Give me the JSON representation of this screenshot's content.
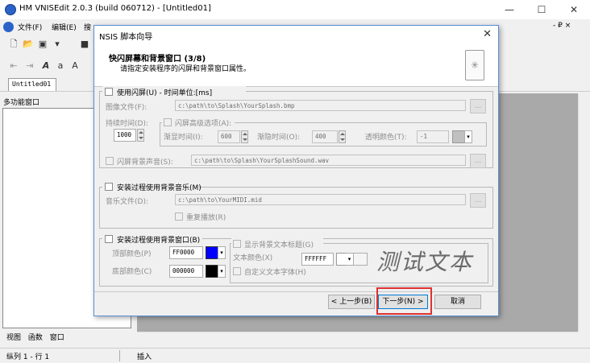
{
  "app": {
    "title": "HM VNISEdit 2.0.3 (build 060712) - [Untitled01]",
    "menu": [
      "文件(F)",
      "编辑(E)",
      "搜"
    ],
    "mdi_controls": "- ₽ ×"
  },
  "tabs": {
    "document": "Untitled01"
  },
  "left_panel": {
    "title": "多功能窗口",
    "tabs": [
      "视图",
      "函数",
      "窗口"
    ]
  },
  "status": {
    "position": "纵列 1 - 行 1",
    "mode": "插入"
  },
  "dialog": {
    "title": "NSIS 脚本向导",
    "heading": "快闪屏幕和背景窗口 (3/8)",
    "subheading": "请指定安装程序的闪屏和背景窗口属性。",
    "splash": {
      "group_label": "使用闪屏(U) - 时间单位:[ms]",
      "image_label": "图像文件(F):",
      "image_value": "c:\\path\\to\\Splash\\YourSplash.bmp",
      "browse": "...",
      "duration_label": "持续时间(D):",
      "duration_value": "1000",
      "advanced_label": "闪屏高级选项(A):",
      "fade_in_label": "渐显时间(I):",
      "fade_in_value": "600",
      "fade_out_label": "渐隐时间(O):",
      "fade_out_value": "400",
      "transparent_label": "透明颜色(T):",
      "transparent_value": "-1",
      "sound_label": "闪屏背景声音(S):",
      "sound_value": "c:\\path\\to\\Splash\\YourSplashSound.wav"
    },
    "music": {
      "group_label": "安装过程使用背景音乐(M)",
      "file_label": "音乐文件(D):",
      "file_value": "c:\\path\\to\\YourMIDI.mid",
      "repeat_label": "重复播放(R)"
    },
    "bgwindow": {
      "group_label": "安装过程使用背景窗口(B)",
      "top_color_label": "顶部颜色(P)",
      "top_color_value": "FF0000",
      "top_swatch": "#0000ff",
      "bottom_color_label": "底部颜色(C)",
      "bottom_color_value": "000000",
      "bottom_swatch": "#000000",
      "show_title_label": "显示背景文本标题(G)",
      "text_color_label": "文本颜色(X)",
      "text_color_value": "FFFFFF",
      "custom_font_label": "自定义文本字体(H)",
      "preview_text": "测试文本"
    },
    "buttons": {
      "back": "< 上一步(B)",
      "next": "下一步(N) >",
      "cancel": "取消"
    }
  }
}
